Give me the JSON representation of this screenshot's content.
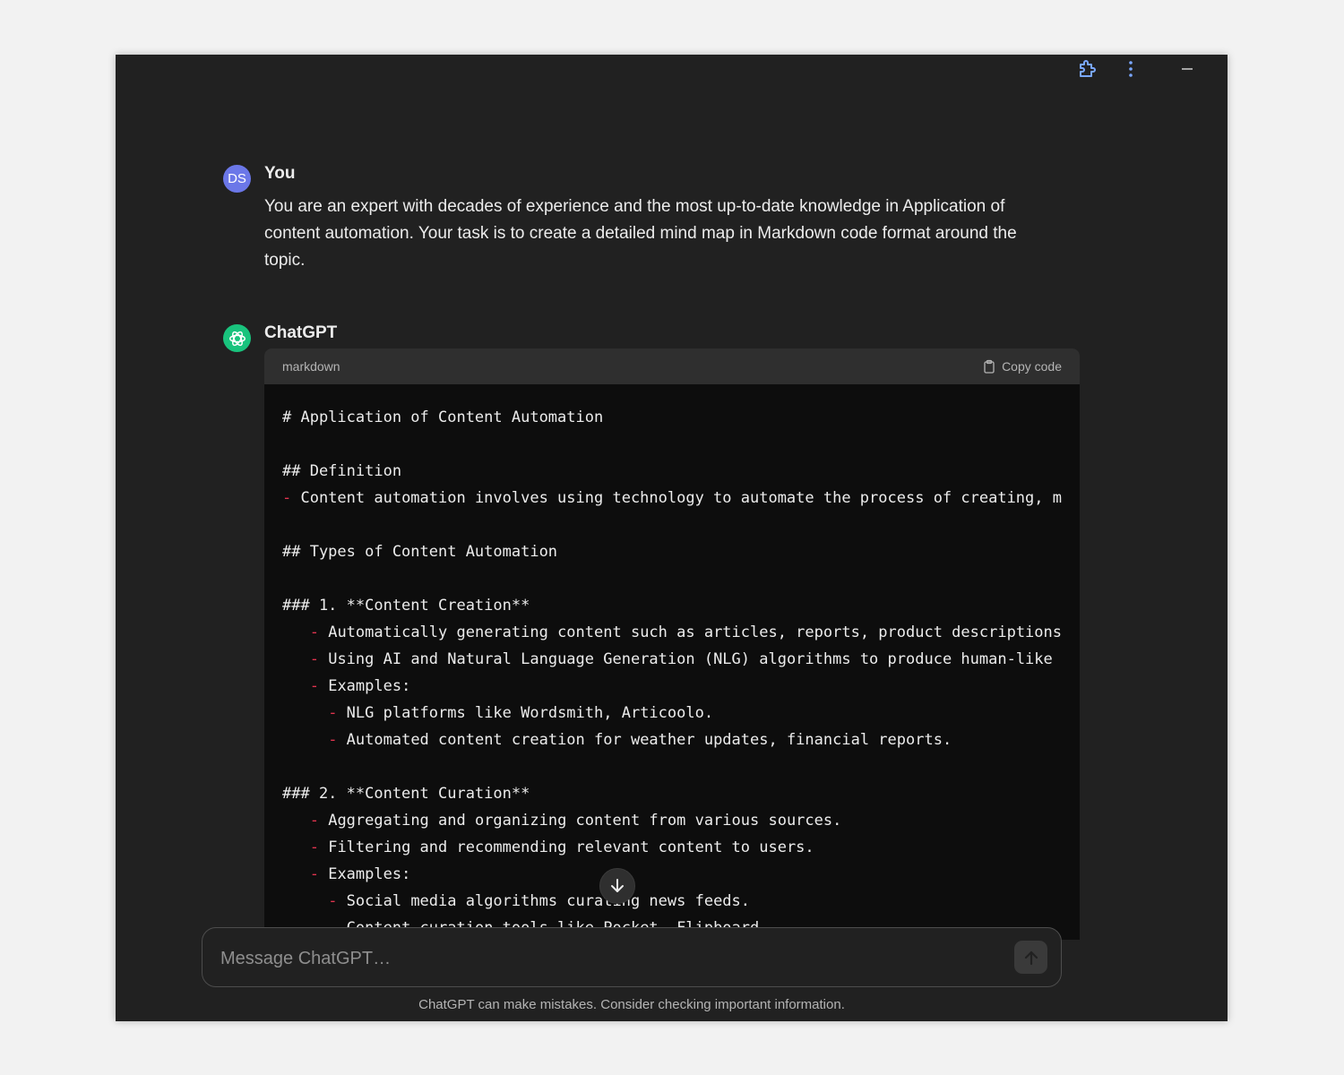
{
  "user_message": {
    "avatar_initials": "DS",
    "author": "You",
    "text": "You are an expert with decades of experience and the most up-to-date knowledge in Application of content automation. Your task is to create a detailed mind map in Markdown code format around the topic."
  },
  "assistant_message": {
    "author": "ChatGPT",
    "code_language": "markdown",
    "copy_label": "Copy code",
    "code_lines": [
      {
        "indent": "",
        "bullet": "",
        "text": "# Application of Content Automation"
      },
      {
        "indent": "",
        "bullet": "",
        "text": ""
      },
      {
        "indent": "",
        "bullet": "",
        "text": "## Definition"
      },
      {
        "indent": "",
        "bullet": "-",
        "text": " Content automation involves using technology to automate the process of creating, m"
      },
      {
        "indent": "",
        "bullet": "",
        "text": ""
      },
      {
        "indent": "",
        "bullet": "",
        "text": "## Types of Content Automation"
      },
      {
        "indent": "",
        "bullet": "",
        "text": ""
      },
      {
        "indent": "",
        "bullet": "",
        "text": "### 1. **Content Creation**"
      },
      {
        "indent": "   ",
        "bullet": "-",
        "text": " Automatically generating content such as articles, reports, product descriptions"
      },
      {
        "indent": "   ",
        "bullet": "-",
        "text": " Using AI and Natural Language Generation (NLG) algorithms to produce human-like"
      },
      {
        "indent": "   ",
        "bullet": "-",
        "text": " Examples:"
      },
      {
        "indent": "     ",
        "bullet": "-",
        "text": " NLG platforms like Wordsmith, Articoolo."
      },
      {
        "indent": "     ",
        "bullet": "-",
        "text": " Automated content creation for weather updates, financial reports."
      },
      {
        "indent": "",
        "bullet": "",
        "text": ""
      },
      {
        "indent": "",
        "bullet": "",
        "text": "### 2. **Content Curation**"
      },
      {
        "indent": "   ",
        "bullet": "-",
        "text": " Aggregating and organizing content from various sources."
      },
      {
        "indent": "   ",
        "bullet": "-",
        "text": " Filtering and recommending relevant content to users."
      },
      {
        "indent": "   ",
        "bullet": "-",
        "text": " Examples:"
      },
      {
        "indent": "     ",
        "bullet": "-",
        "text": " Social media algorithms curating news feeds."
      },
      {
        "indent": "     ",
        "bullet": "-",
        "text": " Content curation tools like Pocket, Flipboard."
      }
    ]
  },
  "composer": {
    "placeholder": "Message ChatGPT…"
  },
  "disclaimer": "ChatGPT can make mistakes. Consider checking important information.",
  "colors": {
    "background": "#212121",
    "code_background": "#0d0d0d",
    "bullet": "#e2344f",
    "user_avatar": "#6b77e8",
    "gpt_avatar": "#19c37d"
  }
}
